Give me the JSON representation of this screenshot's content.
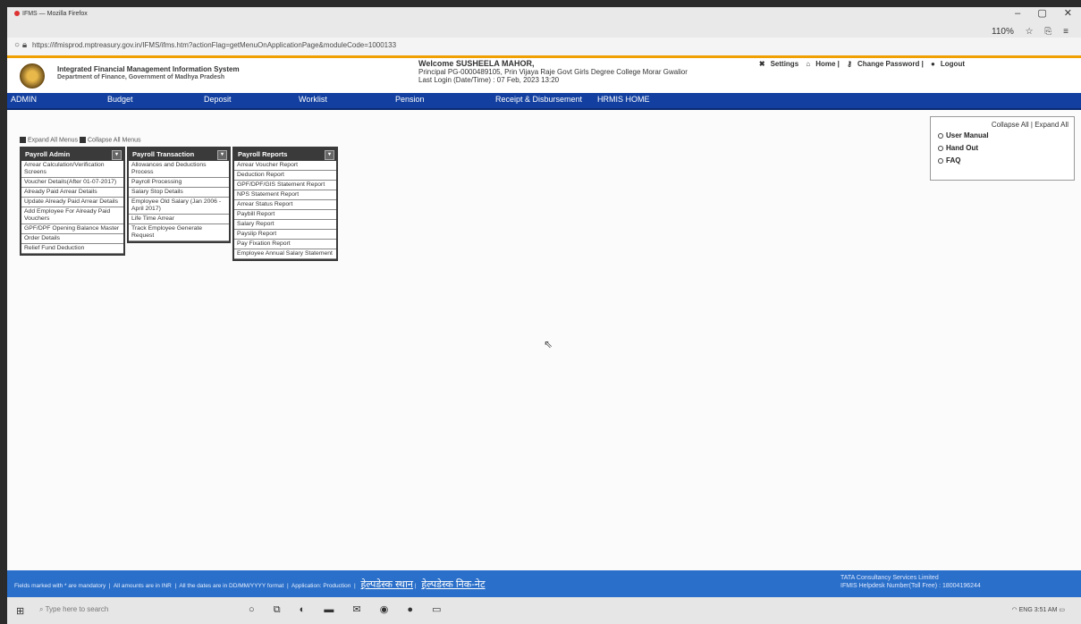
{
  "browser": {
    "tab_title": "IFMS — Mozilla Firefox",
    "url": "https://ifmisprod.mptreasury.gov.in/IFMS/ifms.htm?actionFlag=getMenuOnApplicationPage&moduleCode=1000133",
    "zoom": "110%"
  },
  "header": {
    "system_name": "Integrated Financial Management Information System",
    "department": "Department of Finance, Government of Madhya Pradesh",
    "welcome": "Welcome SUSHEELA MAHOR,",
    "principal": "Principal PG-0000489105, Prin Vijaya Raje Govt Girls Degree College Morar Gwalior",
    "last_login": "Last Login (Date/Time) : 07 Feb, 2023 13:20",
    "links": [
      "Settings",
      "Home |",
      "Change Password |",
      "Logout"
    ]
  },
  "menubar": {
    "items": [
      "ADMIN",
      "Budget",
      "Deposit",
      "Worklist",
      "Pension",
      "Receipt & Disbursement",
      "HRMIS HOME"
    ]
  },
  "controls": {
    "expand_all_menus": "Expand All Menus",
    "collapse_all_menus": "Collapse All Menus"
  },
  "right_panel": {
    "collapse_all": "Collapse All",
    "expand_all": "Expand All",
    "links": [
      "User Manual",
      "Hand Out",
      "FAQ"
    ]
  },
  "payroll_admin": {
    "title": "Payroll Admin",
    "items": [
      "Arrear Calculation/Verification Screens",
      "Voucher Details(After 01-07-2017)",
      "Already Paid Arrear Details",
      "Update Already Paid Arrear Details",
      "Add Employee For Already Paid Vouchers",
      "GPF/DPF Opening Balance Master",
      "Order Details",
      "Relief Fund Deduction"
    ]
  },
  "payroll_transaction": {
    "title": "Payroll Transaction",
    "items": [
      "Allowances and Deductions Process",
      "Payroll Processing",
      "Salary Stop Details",
      "Employee Old Salary (Jan 2006 - April 2017)",
      "Life Time Arrear",
      "Track Employee Generate Request"
    ]
  },
  "payroll_reports": {
    "title": "Payroll Reports",
    "items": [
      "Arrear Voucher Report",
      "Deduction Report",
      "GPF/DPF/GIS Statement Report",
      "NPS Statement Report",
      "Arrear Status Report",
      "Paybill Report",
      "Salary Report",
      "Payslip Report",
      "Pay Fixation Report",
      "Employee Annual Salary Statement"
    ]
  },
  "footer": {
    "mandatory": "Fields marked with * are mandatory",
    "amounts": "All amounts are in INR",
    "dates": "All the dates are in DD/MM/YYYY format",
    "application": "Application: Production",
    "helpdesk_hindi_1": "हेल्पडेस्क स्थान",
    "helpdesk_hindi_2": "हेल्पडेस्क निक-नेट",
    "tcs": "TATA Consultancy Services Limited",
    "helpdesk_number": "IFMIS Helpdesk Number(Toll Free) : 18004196244"
  },
  "taskbar": {
    "search_placeholder": "Type here to search",
    "language": "ENG",
    "time": "3:51 AM"
  }
}
